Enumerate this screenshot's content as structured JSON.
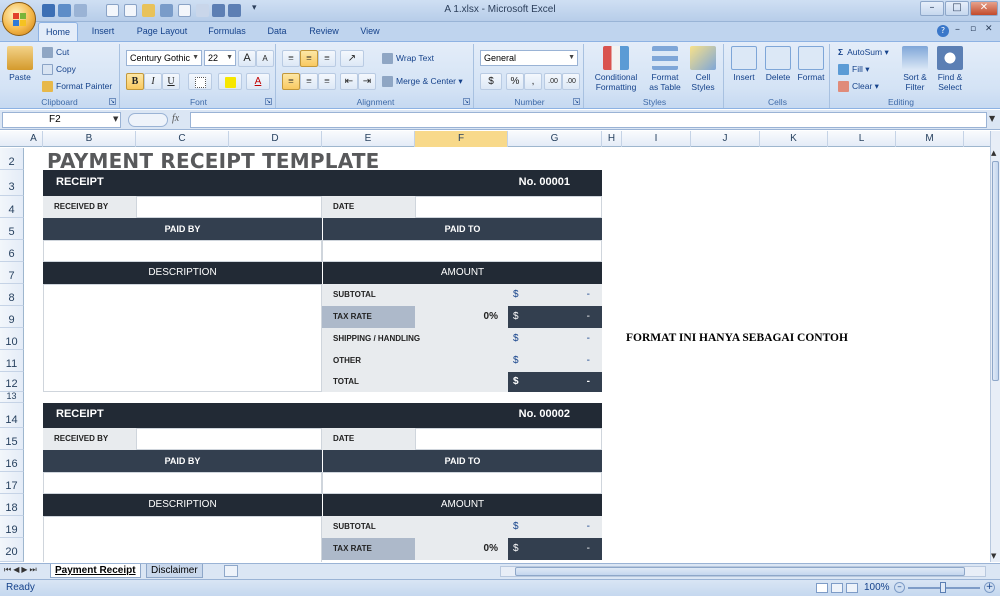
{
  "window": {
    "title": "A 1.xlsx - Microsoft Excel",
    "minimize": "–",
    "maximize": "□",
    "close": "✕"
  },
  "ribbon_tabs": [
    "Home",
    "Insert",
    "Page Layout",
    "Formulas",
    "Data",
    "Review",
    "View"
  ],
  "clipboard": {
    "paste": "Paste",
    "cut": "Cut",
    "copy": "Copy",
    "format_painter": "Format Painter",
    "group": "Clipboard"
  },
  "font": {
    "name": "Century Gothic",
    "size": "22",
    "bold": "B",
    "italic": "I",
    "underline": "U",
    "grow": "A",
    "shrink": "A",
    "font_color": "A",
    "group": "Font"
  },
  "alignment": {
    "wrap": "Wrap Text",
    "merge": "Merge & Center",
    "group": "Alignment"
  },
  "number": {
    "format": "General",
    "currency": "$",
    "percent": "%",
    "comma": ",",
    "inc_dec": ".00",
    "dec_dec": ".00",
    "group": "Number"
  },
  "styles": {
    "conditional": [
      "Conditional",
      "Formatting"
    ],
    "table": [
      "Format",
      "as Table"
    ],
    "cell": [
      "Cell",
      "Styles"
    ],
    "group": "Styles"
  },
  "cells": {
    "insert": "Insert",
    "delete": "Delete",
    "format": "Format",
    "group": "Cells"
  },
  "editing": {
    "autosum": "AutoSum",
    "fill": "Fill",
    "clear": "Clear",
    "sort": [
      "Sort &",
      "Filter"
    ],
    "find": [
      "Find &",
      "Select"
    ],
    "group": "Editing"
  },
  "formula_bar": {
    "name_box": "F2",
    "fx": "fx",
    "value": ""
  },
  "columns": [
    "A",
    "B",
    "C",
    "D",
    "E",
    "F",
    "G",
    "H",
    "I",
    "J",
    "K",
    "L",
    "M"
  ],
  "rows": [
    "2",
    "3",
    "4",
    "5",
    "6",
    "7",
    "8",
    "9",
    "10",
    "11",
    "12",
    "13",
    "14",
    "15",
    "16",
    "17",
    "18",
    "19",
    "20"
  ],
  "sheet": {
    "title": "PAYMENT RECEIPT TEMPLATE",
    "note": "FORMAT INI HANYA SEBAGAI CONTOH",
    "receipt1": {
      "label": "RECEIPT",
      "number": "No. 00001",
      "received_by": "RECEIVED BY",
      "date": "DATE",
      "paid_by": "PAID BY",
      "paid_to": "PAID TO",
      "description": "DESCRIPTION",
      "amount": "AMOUNT",
      "subtotal": "SUBTOTAL",
      "tax_rate": "TAX RATE",
      "tax_value": "0%",
      "shipping": "SHIPPING / HANDLING",
      "other": "OTHER",
      "total": "TOTAL",
      "currency": "$",
      "dash": "-"
    },
    "receipt2": {
      "label": "RECEIPT",
      "number": "No. 00002",
      "received_by": "RECEIVED BY",
      "date": "DATE",
      "paid_by": "PAID BY",
      "paid_to": "PAID TO",
      "description": "DESCRIPTION",
      "amount": "AMOUNT",
      "subtotal": "SUBTOTAL",
      "tax_rate": "TAX RATE",
      "tax_value": "0%",
      "currency": "$",
      "dash": "-"
    }
  },
  "sheet_tabs": {
    "active": "Payment Receipt",
    "other": "Disclaimer"
  },
  "status": {
    "ready": "Ready",
    "zoom": "100%"
  },
  "colors": {
    "dark": "#222a35",
    "slate": "#333f4f",
    "light": "#e8ebee",
    "grey": "#adb9ca",
    "ribbon": "#d4e3f5"
  }
}
